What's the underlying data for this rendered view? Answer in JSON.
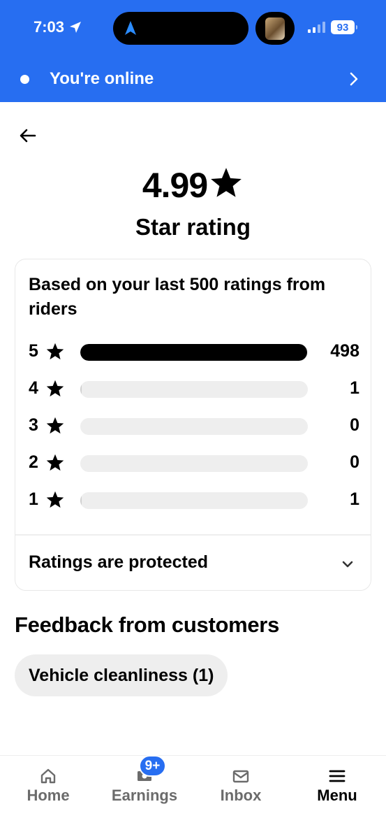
{
  "status_bar": {
    "time": "7:03",
    "battery": "93"
  },
  "banner": {
    "text": "You're online"
  },
  "rating": {
    "value": "4.99",
    "title": "Star rating"
  },
  "breakdown": {
    "description": "Based on your last 500 ratings from riders",
    "total": 500,
    "rows": [
      {
        "stars": "5",
        "count": "498",
        "fraction": 0.996
      },
      {
        "stars": "4",
        "count": "1",
        "fraction": 0.002
      },
      {
        "stars": "3",
        "count": "0",
        "fraction": 0
      },
      {
        "stars": "2",
        "count": "0",
        "fraction": 0
      },
      {
        "stars": "1",
        "count": "1",
        "fraction": 0.002
      }
    ],
    "protected_label": "Ratings are protected"
  },
  "feedback": {
    "title": "Feedback from customers",
    "chips": [
      "Vehicle cleanliness (1)"
    ]
  },
  "nav": {
    "items": [
      {
        "label": "Home",
        "icon": "home-icon",
        "active": false
      },
      {
        "label": "Earnings",
        "icon": "earnings-icon",
        "active": false
      },
      {
        "label": "Inbox",
        "icon": "inbox-icon",
        "active": false,
        "badge": "9+"
      },
      {
        "label": "Menu",
        "icon": "menu-icon",
        "active": true
      }
    ]
  },
  "colors": {
    "brand_blue": "#276ef1",
    "bar_fill": "#000000",
    "bar_track": "#eeeeee",
    "inactive_nav": "#6b6b6b"
  }
}
